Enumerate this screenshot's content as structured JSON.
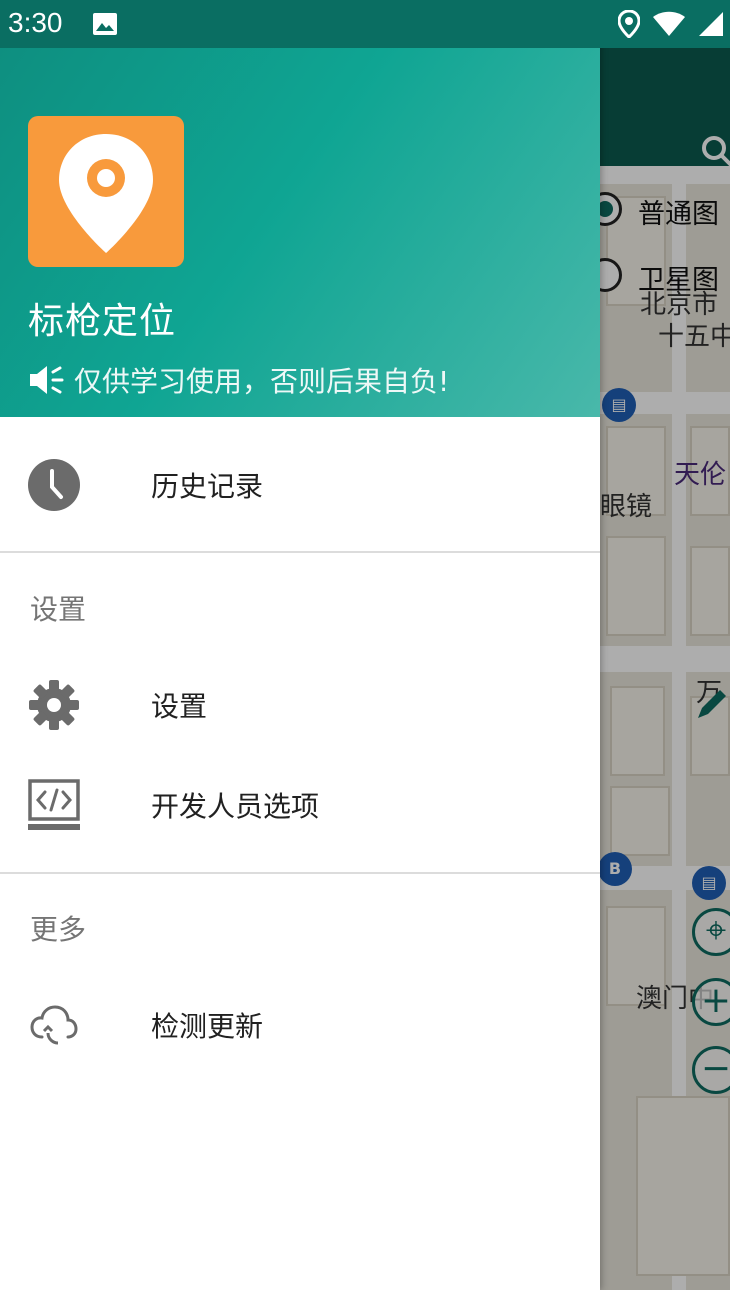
{
  "status_bar": {
    "time": "3:30",
    "icons": [
      "image-icon",
      "location-icon",
      "wifi-icon",
      "signal-icon"
    ]
  },
  "drawer": {
    "app_name": "标枪定位",
    "notice": "仅供学习使用，否则后果自负!",
    "primary_items": [
      {
        "label": "历史记录",
        "icon": "clock-icon"
      }
    ],
    "sections": [
      {
        "title": "设置",
        "items": [
          {
            "label": "设置",
            "icon": "gear-icon"
          },
          {
            "label": "开发人员选项",
            "icon": "code-icon"
          }
        ]
      },
      {
        "title": "更多",
        "items": [
          {
            "label": "检测更新",
            "icon": "cloud-sync-icon"
          }
        ]
      }
    ]
  },
  "background": {
    "map_type_options": [
      {
        "label": "普通图",
        "selected": true
      },
      {
        "label": "卫星图",
        "selected": false
      }
    ],
    "map_labels": [
      "北京市",
      "十五中",
      "天伦",
      "眼镜",
      "万",
      "澳门中"
    ],
    "bus_badge": "B"
  },
  "colors": {
    "header_start": "#0e8f80",
    "header_end": "#49b8aa",
    "logo_bg": "#f89a3c",
    "icon_gray": "#6b6b6b",
    "divider": "#dcdcdc"
  }
}
